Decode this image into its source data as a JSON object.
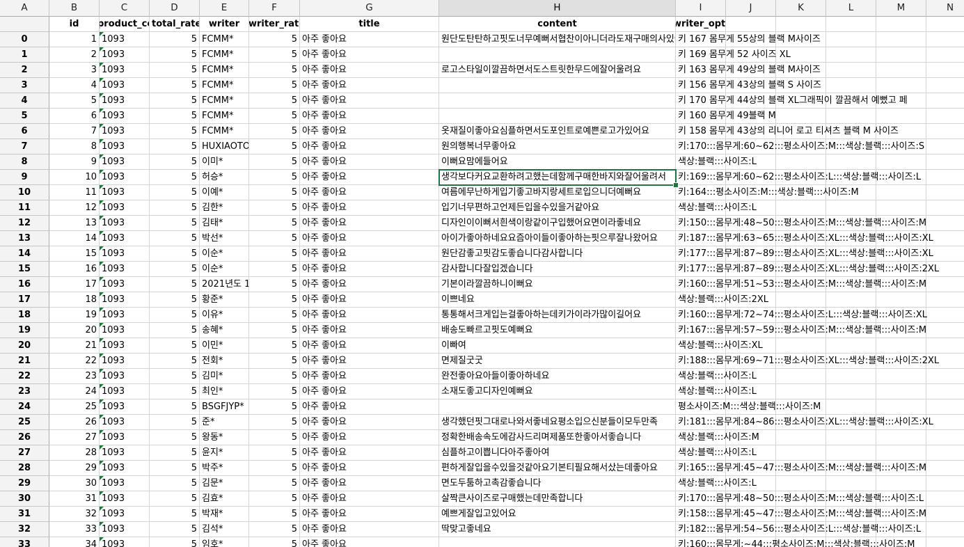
{
  "grid": {
    "column_letters": [
      "A",
      "B",
      "C",
      "D",
      "E",
      "F",
      "G",
      "H",
      "I",
      "J",
      "K",
      "L",
      "M",
      "N"
    ],
    "selected_column": "H",
    "selected_cell_row": 9
  },
  "header_row": {
    "index_label": "",
    "B": "id",
    "C": "product_code",
    "D": "total_rate",
    "E": "writer",
    "F": "writer_rate",
    "G": "title",
    "H": "content",
    "I": "writer_option"
  },
  "rows": [
    {
      "idx": "0",
      "id": "1",
      "code": "1093",
      "rate": "5",
      "writer": "FCMM*",
      "wrate": "5",
      "title": "아주 좋아요",
      "content": "원단도탄탄하고핏도너무예뻐서협찬이아니더라도재구매의사있어요",
      "option": "키  167  몸무게  55상의 블랙 M사이즈"
    },
    {
      "idx": "1",
      "id": "2",
      "code": "1093",
      "rate": "5",
      "writer": "FCMM*",
      "wrate": "5",
      "title": "아주 좋아요",
      "content": "",
      "option": "키  169  몸무게  52 사이즈 XL"
    },
    {
      "idx": "2",
      "id": "3",
      "code": "1093",
      "rate": "5",
      "writer": "FCMM*",
      "wrate": "5",
      "title": "아주 좋아요",
      "content": "로고스타일이깔끔하면서도스트릿한무드에잘어울려요",
      "option": "키  163  몸무게  49상의 블랙 M사이즈"
    },
    {
      "idx": "3",
      "id": "4",
      "code": "1093",
      "rate": "5",
      "writer": "FCMM*",
      "wrate": "5",
      "title": "아주 좋아요",
      "content": "",
      "option": "키  156  몸무게  43상의 블랙 S 사이즈"
    },
    {
      "idx": "4",
      "id": "5",
      "code": "1093",
      "rate": "5",
      "writer": "FCMM*",
      "wrate": "5",
      "title": "아주 좋아요",
      "content": "",
      "option": "키  170  몸무게  44상의 블랙 XL그래픽이 깔끔해서 예뻤고 페"
    },
    {
      "idx": "5",
      "id": "6",
      "code": "1093",
      "rate": "5",
      "writer": "FCMM*",
      "wrate": "5",
      "title": "아주 좋아요",
      "content": "",
      "option": "키  160  몸무게  49블랙 M"
    },
    {
      "idx": "6",
      "id": "7",
      "code": "1093",
      "rate": "5",
      "writer": "FCMM*",
      "wrate": "5",
      "title": "아주 좋아요",
      "content": "옷재질이좋아요심플하면서도포인트로예쁜로고가있어요",
      "option": "키  158  몸무게  43상의 리니어 로고 티셔츠  블랙 M  사이즈"
    },
    {
      "idx": "7",
      "id": "8",
      "code": "1093",
      "rate": "5",
      "writer": "HUXIAOTONG",
      "wrate": "5",
      "title": "아주 좋아요",
      "content": "원의행복너무좋아요",
      "option": "키:170:::몸무게:60~62:::평소사이즈:M:::색상:블랙:::사이즈:S"
    },
    {
      "idx": "8",
      "id": "9",
      "code": "1093",
      "rate": "5",
      "writer": "이미*",
      "wrate": "5",
      "title": "아주 좋아요",
      "content": "이뻐요맘에들어요",
      "option": "색상:블랙:::사이즈:L"
    },
    {
      "idx": "9",
      "id": "10",
      "code": "1093",
      "rate": "5",
      "writer": "허승*",
      "wrate": "5",
      "title": "아주 좋아요",
      "content": "생각보다커요교환하려고했는데함께구매한바지와잘어울려서",
      "option": "키:169:::몸무게:60~62:::평소사이즈:L:::색상:블랙:::사이즈:L"
    },
    {
      "idx": "10",
      "id": "11",
      "code": "1093",
      "rate": "5",
      "writer": "이예*",
      "wrate": "5",
      "title": "아주 좋아요",
      "content": "여름에무난하게입기좋고바지랑세트로입으니더예뻐요",
      "option": "키:164:::평소사이즈:M:::색상:블랙:::사이즈:M"
    },
    {
      "idx": "11",
      "id": "12",
      "code": "1093",
      "rate": "5",
      "writer": "김한*",
      "wrate": "5",
      "title": "아주 좋아요",
      "content": "입기너무편하고언제든입을수있을거같아요",
      "option": "색상:블랙:::사이즈:L"
    },
    {
      "idx": "12",
      "id": "13",
      "code": "1093",
      "rate": "5",
      "writer": "김태*",
      "wrate": "5",
      "title": "아주 좋아요",
      "content": "디자인이이뻐서흰색이랑같이구입했어요면이라좋네요",
      "option": "키:150:::몸무게:48~50:::평소사이즈:M:::색상:블랙:::사이즈:M"
    },
    {
      "idx": "13",
      "id": "14",
      "code": "1093",
      "rate": "5",
      "writer": "박선*",
      "wrate": "5",
      "title": "아주 좋아요",
      "content": "아이가좋아하네요요즘아이들이좋아하는핏으루잘나왔어요",
      "option": "키:187:::몸무게:63~65:::평소사이즈:XL:::색상:블랙:::사이즈:XL"
    },
    {
      "idx": "14",
      "id": "15",
      "code": "1093",
      "rate": "5",
      "writer": "이순*",
      "wrate": "5",
      "title": "아주 좋아요",
      "content": "원단감좋고핏감도좋습니다감사합니다",
      "option": "키:177:::몸무게:87~89:::평소사이즈:XL:::색상:블랙:::사이즈:XL"
    },
    {
      "idx": "15",
      "id": "16",
      "code": "1093",
      "rate": "5",
      "writer": "이순*",
      "wrate": "5",
      "title": "아주 좋아요",
      "content": "감사합니다잘입겠습니다",
      "option": "키:177:::몸무게:87~89:::평소사이즈:XL:::색상:블랙:::사이즈:2XL"
    },
    {
      "idx": "16",
      "id": "17",
      "code": "1093",
      "rate": "5",
      "writer": "2021년도 1",
      "wrate": "5",
      "title": "아주 좋아요",
      "content": "기본이라깔끔하니이뻐요",
      "option": "키:160:::몸무게:51~53:::평소사이즈:M:::색상:블랙:::사이즈:M"
    },
    {
      "idx": "17",
      "id": "18",
      "code": "1093",
      "rate": "5",
      "writer": "황준*",
      "wrate": "5",
      "title": "아주 좋아요",
      "content": "이쁘네요",
      "option": "색상:블랙:::사이즈:2XL"
    },
    {
      "idx": "18",
      "id": "19",
      "code": "1093",
      "rate": "5",
      "writer": "이유*",
      "wrate": "5",
      "title": "아주 좋아요",
      "content": "통통해서크게입는걸좋아하는데키가이라가많이길어요",
      "option": "키:160:::몸무게:72~74:::평소사이즈:L:::색상:블랙:::사이즈:XL"
    },
    {
      "idx": "19",
      "id": "20",
      "code": "1093",
      "rate": "5",
      "writer": "송혜*",
      "wrate": "5",
      "title": "아주 좋아요",
      "content": "배송도빠르고핏도예뻐요",
      "option": "키:167:::몸무게:57~59:::평소사이즈:M:::색상:블랙:::사이즈:M"
    },
    {
      "idx": "20",
      "id": "21",
      "code": "1093",
      "rate": "5",
      "writer": "이민*",
      "wrate": "5",
      "title": "아주 좋아요",
      "content": "이빠여",
      "option": "색상:블랙:::사이즈:XL"
    },
    {
      "idx": "21",
      "id": "22",
      "code": "1093",
      "rate": "5",
      "writer": "전회*",
      "wrate": "5",
      "title": "아주 좋아요",
      "content": "면제질굿굿",
      "option": "키:188:::몸무게:69~71:::평소사이즈:XL:::색상:블랙:::사이즈:2XL"
    },
    {
      "idx": "22",
      "id": "23",
      "code": "1093",
      "rate": "5",
      "writer": "김미*",
      "wrate": "5",
      "title": "아주 좋아요",
      "content": "완전좋아요아들이좋아하네요",
      "option": "색상:블랙:::사이즈:L"
    },
    {
      "idx": "23",
      "id": "24",
      "code": "1093",
      "rate": "5",
      "writer": "최인*",
      "wrate": "5",
      "title": "아주 좋아요",
      "content": "소재도좋고디자인예뻐요",
      "option": "색상:블랙:::사이즈:L"
    },
    {
      "idx": "24",
      "id": "25",
      "code": "1093",
      "rate": "5",
      "writer": "BSGFJYP*",
      "wrate": "5",
      "title": "아주 좋아요",
      "content": "",
      "option": "평소사이즈:M:::색상:블랙:::사이즈:M"
    },
    {
      "idx": "25",
      "id": "26",
      "code": "1093",
      "rate": "5",
      "writer": "준*",
      "wrate": "5",
      "title": "아주 좋아요",
      "content": "생각했던핏그대로나와서좋네요평소입으신분들이모두만족",
      "option": "키:181:::몸무게:84~86:::평소사이즈:XL:::색상:블랙:::사이즈:XL"
    },
    {
      "idx": "26",
      "id": "27",
      "code": "1093",
      "rate": "5",
      "writer": "왕동*",
      "wrate": "5",
      "title": "아주 좋아요",
      "content": "정확한배송속도에감사드리며제품또한좋아서좋습니다",
      "option": "색상:블랙:::사이즈:M"
    },
    {
      "idx": "27",
      "id": "28",
      "code": "1093",
      "rate": "5",
      "writer": "윤지*",
      "wrate": "5",
      "title": "아주 좋아요",
      "content": "심플하고이쁩니다아주좋아여",
      "option": "색상:블랙:::사이즈:L"
    },
    {
      "idx": "28",
      "id": "29",
      "code": "1093",
      "rate": "5",
      "writer": "박주*",
      "wrate": "5",
      "title": "아주 좋아요",
      "content": "편하게잘입을수있을것같아요기본티필요해서샀는데좋아요",
      "option": "키:165:::몸무게:45~47:::평소사이즈:M:::색상:블랙:::사이즈:M"
    },
    {
      "idx": "29",
      "id": "30",
      "code": "1093",
      "rate": "5",
      "writer": "김문*",
      "wrate": "5",
      "title": "아주 좋아요",
      "content": "면도두툼하고촉감좋습니다",
      "option": "색상:블랙:::사이즈:L"
    },
    {
      "idx": "30",
      "id": "31",
      "code": "1093",
      "rate": "5",
      "writer": "김효*",
      "wrate": "5",
      "title": "아주 좋아요",
      "content": "살짝큰사이즈로구매했는데만족합니다",
      "option": "키:170:::몸무게:48~50:::평소사이즈:M:::색상:블랙:::사이즈:L"
    },
    {
      "idx": "31",
      "id": "32",
      "code": "1093",
      "rate": "5",
      "writer": "박재*",
      "wrate": "5",
      "title": "아주 좋아요",
      "content": "예쁘게잘입고있어요",
      "option": "키:158:::몸무게:45~47:::평소사이즈:M:::색상:블랙:::사이즈:M"
    },
    {
      "idx": "32",
      "id": "33",
      "code": "1093",
      "rate": "5",
      "writer": "김석*",
      "wrate": "5",
      "title": "아주 좋아요",
      "content": "딱맞고좋네요",
      "option": "키:182:::몸무게:54~56:::평소사이즈:L:::색상:블랙:::사이즈:L"
    },
    {
      "idx": "33",
      "id": "34",
      "code": "1093",
      "rate": "5",
      "writer": "임호*",
      "wrate": "5",
      "title": "아주 좋아요",
      "content": "",
      "option": "키:160:::몸무게:~44:::평소사이즈:M:::색상:블랙:::사이즈:M"
    }
  ]
}
